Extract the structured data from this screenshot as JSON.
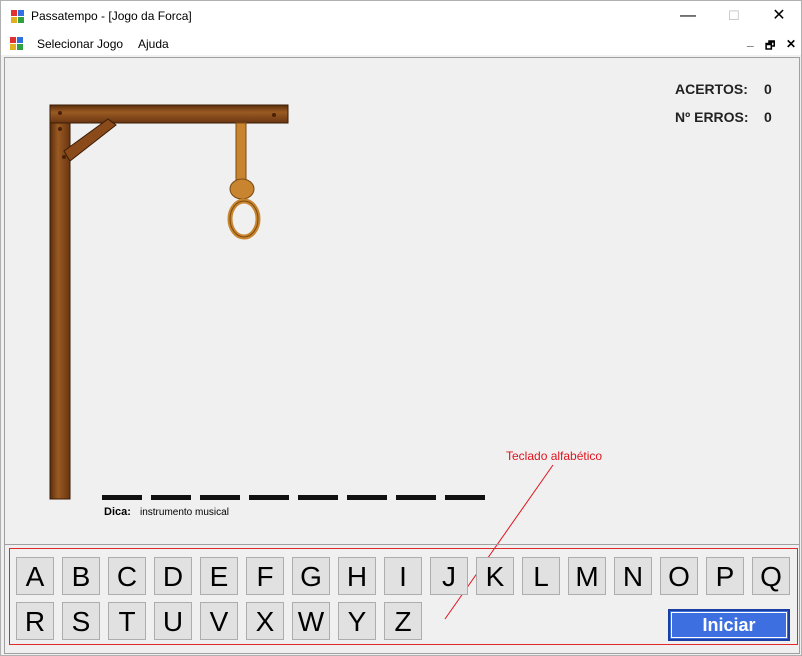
{
  "window": {
    "title": "Passatempo - [Jogo da Forca]",
    "minimize": "—",
    "maximize": "☐",
    "close": "✕"
  },
  "menu": {
    "select_game": "Selecionar Jogo",
    "help": "Ajuda",
    "mdi_min": "_",
    "mdi_restore": "🗗",
    "mdi_close": "✕"
  },
  "stats": {
    "acertos_label": "ACERTOS:",
    "acertos_value": "0",
    "erros_label": "Nº ERROS:",
    "erros_value": "0"
  },
  "word": {
    "letter_count": 8
  },
  "hint": {
    "label": "Dica:",
    "text": "instrumento musical"
  },
  "annotation": {
    "text": "Teclado alfabético"
  },
  "keyboard": {
    "row1": [
      "A",
      "B",
      "C",
      "D",
      "E",
      "F",
      "G",
      "H",
      "I",
      "J",
      "K",
      "L",
      "M",
      "N",
      "O",
      "P",
      "Q"
    ],
    "row2": [
      "R",
      "S",
      "T",
      "U",
      "V",
      "X",
      "W",
      "Y",
      "Z"
    ]
  },
  "start_button": "Iniciar",
  "colors": {
    "wood": "#8b4a1a",
    "rope": "#c8842e",
    "button_blue": "#3d6fe0",
    "annotation_red": "#e0141e"
  }
}
